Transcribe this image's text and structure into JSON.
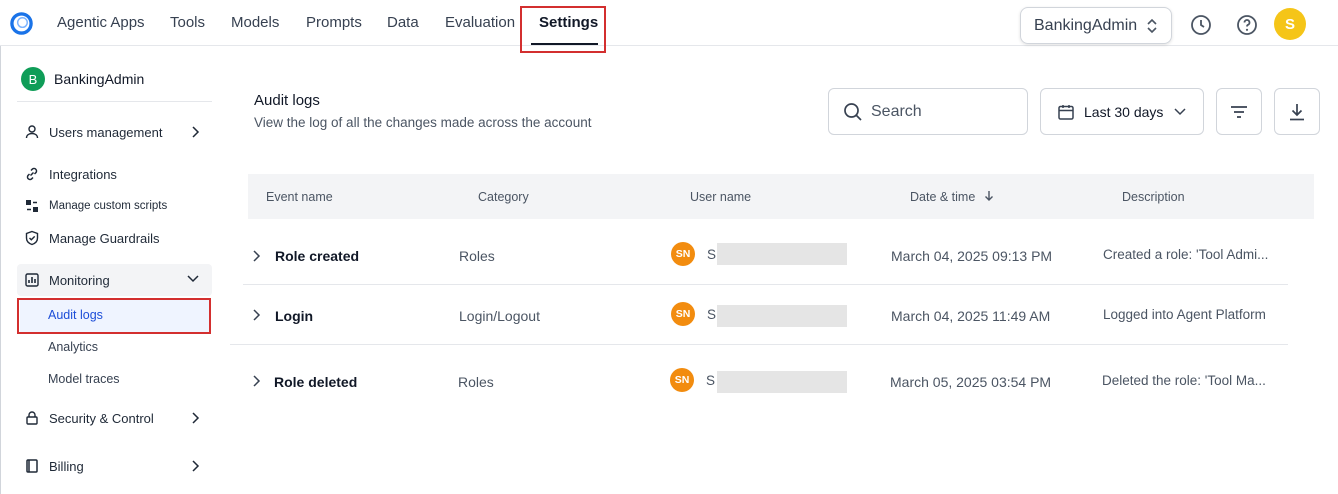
{
  "nav": {
    "tabs": [
      "Agentic Apps",
      "Tools",
      "Models",
      "Prompts",
      "Data",
      "Evaluation",
      "Settings"
    ],
    "active": "Settings",
    "account": "BankingAdmin",
    "user_initial": "S"
  },
  "sidebar": {
    "workspace_initial": "B",
    "workspace_name": "BankingAdmin",
    "items": {
      "users": "Users management",
      "integrations": "Integrations",
      "scripts": "Manage custom scripts",
      "guardrails": "Manage Guardrails",
      "monitoring": "Monitoring",
      "security": "Security & Control",
      "billing": "Billing"
    },
    "monitoring_children": [
      "Audit logs",
      "Analytics",
      "Model traces"
    ],
    "active_child": "Audit logs"
  },
  "header": {
    "title": "Audit logs",
    "subtitle": "View the log of all the changes made across the account",
    "search_placeholder": "Search",
    "date_range": "Last 30 days"
  },
  "table": {
    "columns": [
      "Event name",
      "Category",
      "User name",
      "Date & time",
      "Description"
    ],
    "rows": [
      {
        "event": "Role created",
        "category": "Roles",
        "user_initials": "SN",
        "user_name": "S",
        "datetime": "March 04, 2025 09:13 PM",
        "description": "Created a role: 'Tool Admi..."
      },
      {
        "event": "Login",
        "category": "Login/Logout",
        "user_initials": "SN",
        "user_name": "S",
        "datetime": "March 04, 2025 11:49 AM",
        "description": "Logged into Agent Platform"
      },
      {
        "event": "Role deleted",
        "category": "Roles",
        "user_initials": "SN",
        "user_name": "S",
        "datetime": "March 05, 2025 03:54 PM",
        "description": "Deleted the role: 'Tool Ma..."
      }
    ]
  },
  "colors": {
    "highlight": "#d32f2f",
    "user_avatar": "#f28c0f",
    "top_avatar": "#f5c518",
    "workspace_badge": "#0f9d58",
    "logo": "#1a73e8"
  }
}
